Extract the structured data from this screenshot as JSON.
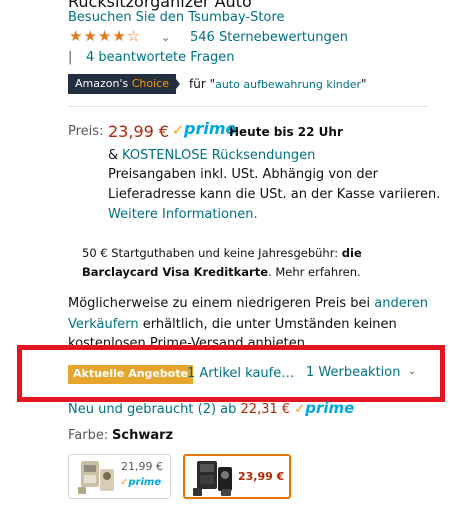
{
  "header": {
    "cut_title": "Rücksitzorganizer Auto",
    "store_link": "Besuchen Sie den Tsumbay-Store",
    "rating": {
      "stars_value": 4.0,
      "stars_glyphs": "★★★★☆",
      "count_text": "546 Sternebewertungen"
    },
    "qa_separator": "|",
    "qa_link": "4 beantwortete Fragen"
  },
  "choice": {
    "badge_amazons": "Amazon's",
    "badge_choice": "Choice",
    "for_prefix": "für \"",
    "query": "auto aufbewahrung kinder",
    "for_suffix": "\""
  },
  "price": {
    "label": "Preis:",
    "value": "23,99 €",
    "prime_check": "✓",
    "prime_word": "prime",
    "delivery": "Heute bis 22 Uhr",
    "returns_amp": "&",
    "returns_link": "KOSTENLOSE Rücksendungen",
    "tax_line1": "Preisangaben inkl. USt. Abhängig von der",
    "tax_line2": "Lieferadresse kann die USt. an der Kasse variieren.",
    "more_info": "Weitere Informationen."
  },
  "barclaycard": {
    "line1_prefix": "50 € Startguthaben und keine Jahresgebühr: ",
    "line1_bold": "die",
    "line2_bold": "Barclaycard Visa Kreditkarte",
    "line2_suffix": ". Mehr erfahren."
  },
  "cheaper": {
    "line1_prefix": "Möglicherweise zu einem niedrigeren Preis bei ",
    "line1_link": "anderen",
    "line2_link": "Verkäufern",
    "line2_suffix": " erhältlich, die unter Umständen keinen",
    "line3": "kostenlosen Prime-Versand anbieten."
  },
  "deals": {
    "badge": "Aktuelle Angebote",
    "items_text": "1 Artikel kaufe…",
    "promo_text": "1 Werbeaktion",
    "chevron": "⌄"
  },
  "used": {
    "prefix": "Neu und gebraucht (2) ab ",
    "price": "22,31 €",
    "check": "✓",
    "prime": "prime"
  },
  "color": {
    "label": "Farbe:",
    "value": "Schwarz"
  },
  "swatches": [
    {
      "price": "21,99 €",
      "prime_check": "✓",
      "prime": "prime",
      "selected": false
    },
    {
      "price": "23,99 €",
      "selected": true
    }
  ],
  "colors": {
    "link": "#007185",
    "price": "#b12704",
    "prime_blue": "#00a8e1",
    "prime_orange": "#ff9900",
    "choice_bg": "#232f3e",
    "deals_badge": "#e6a62e",
    "highlight_red": "#e3161f"
  }
}
